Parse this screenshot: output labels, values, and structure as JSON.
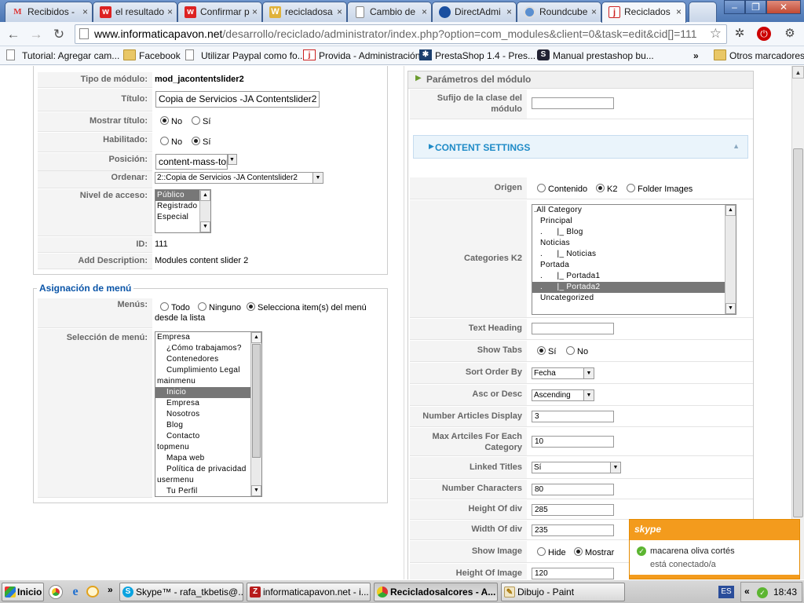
{
  "browser": {
    "tabs": [
      {
        "label": "Recibidos - ",
        "icon": "M"
      },
      {
        "label": "el resultado",
        "icon": "w"
      },
      {
        "label": "Confirmar p",
        "icon": "w"
      },
      {
        "label": "recicladosa",
        "icon": "W"
      },
      {
        "label": "Cambio de",
        "icon": ""
      },
      {
        "label": "DirectAdmi",
        "icon": ""
      },
      {
        "label": "Roundcube",
        "icon": ""
      },
      {
        "label": "Reciclados",
        "icon": "j"
      }
    ],
    "tab_close": "×",
    "url_domain": "www.informaticapavon.net",
    "url_rest": "/desarrollo/reciclado/administrator/index.php?option=com_modules&client=0&task=edit&cid[]=111",
    "bookmarks": [
      {
        "label": "Tutorial: Agregar cam...",
        "icon": "page"
      },
      {
        "label": "Facebook",
        "icon": "folder"
      },
      {
        "label": "Utilizar Paypal como fo...",
        "icon": "page"
      },
      {
        "label": "Provida - Administración",
        "icon": "joomla"
      },
      {
        "label": "PrestaShop 1.4 - Pres...",
        "icon": "prestashop"
      },
      {
        "label": "Manual prestashop bu...",
        "icon": "s"
      },
      {
        "label": "Otros marcadores",
        "icon": "folder"
      }
    ],
    "bookmarks_more": "»"
  },
  "module": {
    "labels": {
      "type": "Tipo de módulo:",
      "title": "Título:",
      "show_title": "Mostrar título:",
      "enabled": "Habilitado:",
      "position": "Posición:",
      "order": "Ordenar:",
      "access": "Nivel de acceso:",
      "id": "ID:",
      "description": "Add Description:"
    },
    "type_value": "mod_jacontentslider2",
    "title_value": "Copia de Servicios -JA Contentslider2",
    "no": "No",
    "yes": "Sí",
    "position_value": "content-mass-top",
    "order_value": "2::Copia de Servicios -JA Contentslider2",
    "access_levels": [
      "Público",
      "Registrado",
      "Especial"
    ],
    "id_value": "111",
    "description_value": "Modules content slider 2"
  },
  "menu_assignment": {
    "legend": "Asignación de menú",
    "menus_label": "Menús:",
    "opt_all": "Todo",
    "opt_none": "Ninguno",
    "opt_select": "Selecciona item(s) del menú",
    "opt_select_cont": "desde la lista",
    "selection_label": "Selección de menú:",
    "items": [
      "Empresa",
      "¿Cómo trabajamos?",
      "Contenedores",
      "Cumplimiento Legal",
      "mainmenu",
      "Inicio",
      "Empresa",
      "Nosotros",
      "Blog",
      "Contacto",
      "topmenu",
      "Mapa web",
      "Política de privacidad",
      "usermenu",
      "Tu Perfil"
    ]
  },
  "params": {
    "header": "Parámetros del módulo",
    "suffix_label": "Sufijo de la clase del módulo",
    "content_settings": "CONTENT SETTINGS",
    "origin_label": "Origen",
    "origin_opts": [
      "Contenido",
      "K2",
      "Folder Images"
    ],
    "categories_label": "Categories K2",
    "categories": [
      ".All Category",
      "Principal",
      ".      |_ Blog",
      "Noticias",
      ".      |_ Noticias",
      "Portada",
      ".      |_ Portada1",
      ".      |_ Portada2",
      "Uncategorized"
    ],
    "text_heading_label": "Text Heading",
    "show_tabs_label": "Show Tabs",
    "si": "Sí",
    "no": "No",
    "sort_label": "Sort Order By",
    "sort_value": "Fecha",
    "ascdesc_label": "Asc or Desc",
    "ascdesc_value": "Ascending",
    "num_display_label": "Number Articles Display",
    "num_display_value": "3",
    "max_label": "Max Artciles For Each Category",
    "max_value": "10",
    "linked_label": "Linked Titles",
    "linked_value": "Sí",
    "num_chars_label": "Number Characters",
    "num_chars_value": "80",
    "height_div_label": "Height Of div",
    "height_div_value": "285",
    "width_div_label": "Width Of div",
    "width_div_value": "235",
    "show_image_label": "Show Image",
    "hide": "Hide",
    "show": "Mostrar",
    "height_img_label": "Height Of Image",
    "height_img_value": "120"
  },
  "skype_popup": {
    "logo": "skype",
    "name": "macarena oliva cortés",
    "status": "está conectado/a"
  },
  "taskbar": {
    "start": "Inicio",
    "more": "»",
    "buttons": [
      "Skype™ - rafa_tkbetis@...",
      "informaticapavon.net - i...",
      "Recicladosalcores - A...",
      "Dibujo - Paint"
    ],
    "lang": "ES",
    "tray_more": "«",
    "clock": "18:43"
  }
}
